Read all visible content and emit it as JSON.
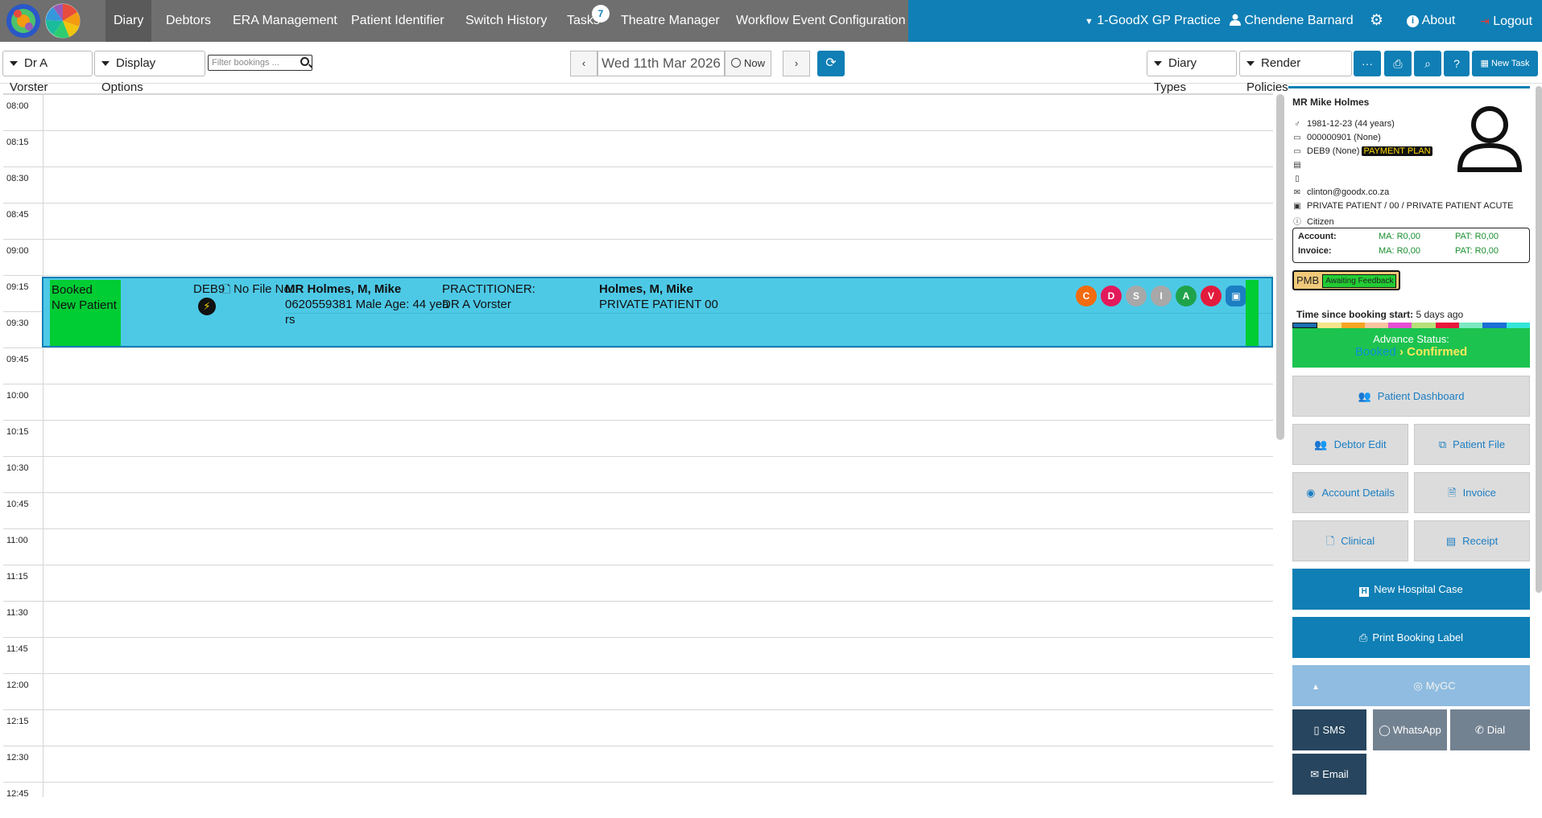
{
  "nav": {
    "items": [
      "Diary",
      "Debtors",
      "ERA Management",
      "Patient Identifier",
      "Switch History",
      "Tasks",
      "Theatre Manager",
      "Workflow Event Configuration"
    ],
    "tasks_badge": "7",
    "practice": "1-GoodX GP Practice",
    "user": "Chendene Barnard",
    "about": "About",
    "logout": "Logout"
  },
  "toolbar": {
    "doctor": "Dr A Vorster",
    "display_options": "Display Options",
    "filter_placeholder": "Filter bookings ...",
    "date": "Wed 11th Mar 2026",
    "now": "Now",
    "diary_types": "Diary Types",
    "render_policies": "Render Policies",
    "new_task": "New Task"
  },
  "times": [
    "08:00",
    "08:15",
    "08:30",
    "08:45",
    "09:00",
    "09:15",
    "09:30",
    "09:45",
    "10:00",
    "10:15",
    "10:30",
    "10:45",
    "11:00",
    "11:15",
    "11:30",
    "11:45",
    "12:00",
    "12:15",
    "12:30",
    "12:45"
  ],
  "booking": {
    "status_line1": "Booked",
    "status_line2": "New Patient",
    "debtor": "DEB9",
    "file": "No File No.",
    "patient_name": "MR Holmes, M, Mike",
    "patient_details_1": "0620559381 Male Age: 44 yea",
    "patient_details_2": "rs",
    "practitioner_label": "PRACTITIONER:",
    "practitioner": "DR A Vorster",
    "main_member": "Holmes, M, Mike",
    "scheme": "PRIVATE PATIENT 00",
    "actions": [
      {
        "letter": "C",
        "color": "#f26b0f"
      },
      {
        "letter": "D",
        "color": "#e3195b"
      },
      {
        "letter": "S",
        "color": "#a8a8a8"
      },
      {
        "letter": "I",
        "color": "#a8a8a8"
      },
      {
        "letter": "A",
        "color": "#1fa34a"
      },
      {
        "letter": "V",
        "color": "#e21b3c"
      }
    ]
  },
  "patient": {
    "name": "MR Mike Holmes",
    "dob": "1981-12-23 (44 years)",
    "file": "000000901 (None)",
    "debtor": "DEB9 (None)",
    "debtor_tag": "PAYMENT PLAN",
    "email": "clinton@goodx.co.za",
    "medical_aid": "PRIVATE PATIENT / 00 / PRIVATE PATIENT ACUTE",
    "citizenship": "Citizen",
    "account_label": "Account:",
    "account_ma": "MA: R0,00",
    "account_pat": "PAT: R0,00",
    "invoice_label": "Invoice:",
    "invoice_ma": "MA: R0,00",
    "invoice_pat": "PAT: R0,00",
    "pmb": "PMB",
    "pmb_status": "Awaiting Feedback",
    "time_since_label": "Time since booking start:",
    "time_since_value": "5 days ago",
    "timeline_colors": [
      "#1a6fb0",
      "#f3e58a",
      "#f6a623",
      "#f7c59f",
      "#e44fd3",
      "#b6e07a",
      "#e8173c",
      "#7be8c1",
      "#1a6fd6",
      "#33e5d9"
    ],
    "advance_label": "Advance Status:",
    "advance_from": "Booked",
    "advance_to": "Confirmed"
  },
  "actions": {
    "patient_dashboard": "Patient Dashboard",
    "debtor_edit": "Debtor Edit",
    "patient_file": "Patient File",
    "account_details": "Account Details",
    "invoice": "Invoice",
    "clinical": "Clinical",
    "receipt": "Receipt",
    "new_hospital_case": "New Hospital Case",
    "print_booking_label": "Print Booking Label",
    "mygc": "MyGC",
    "sms": "SMS",
    "whatsapp": "WhatsApp",
    "dial": "Dial",
    "email": "Email"
  }
}
